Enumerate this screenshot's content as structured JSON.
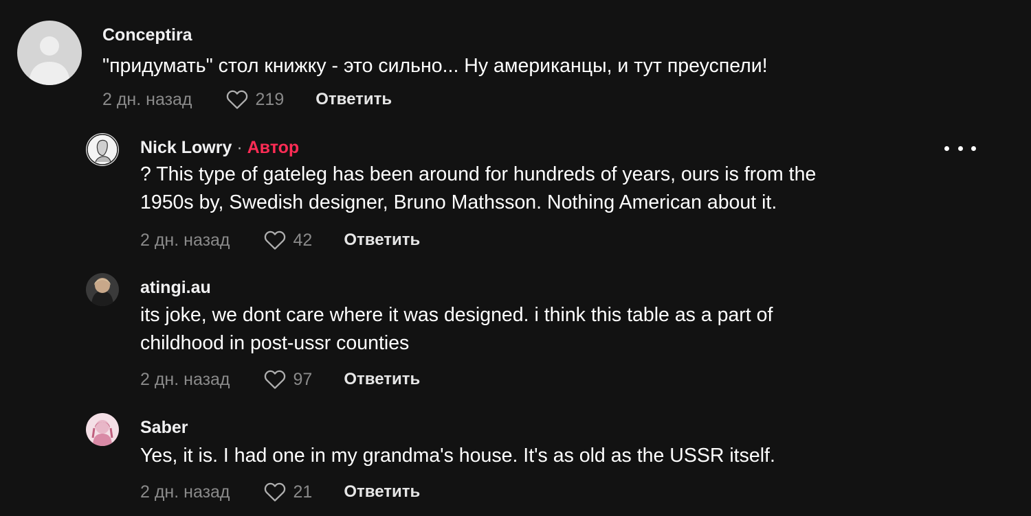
{
  "comments": [
    {
      "username": "Conceptira",
      "text": "\"придумать\" стол книжку - это сильно... Ну американцы, и тут преуспели!",
      "time": "2 дн. назад",
      "likes": "219",
      "reply_label": "Ответить"
    }
  ],
  "replies": [
    {
      "username": "Nick Lowry",
      "separator": "·",
      "author_tag": "Автор",
      "text_lines": [
        "? This type of gateleg has been around for hundreds of years, ours is from the",
        "1950s by, Swedish designer, Bruno Mathsson. Nothing American about it."
      ],
      "time": "2 дн. назад",
      "likes": "42",
      "reply_label": "Ответить"
    },
    {
      "username": "atingi.au",
      "text_lines": [
        "its joke, we dont care where it was designed. i think this table as a part of",
        "childhood in post-ussr counties"
      ],
      "time": "2 дн. назад",
      "likes": "97",
      "reply_label": "Ответить"
    },
    {
      "username": "Saber",
      "text_lines": [
        "Yes, it is. I had one in my grandma's house. It's as old as the USSR itself."
      ],
      "time": "2 дн. назад",
      "likes": "21",
      "reply_label": "Ответить"
    }
  ],
  "icons": {
    "like": "heart-outline-icon",
    "more": "more-horizontal-icon"
  },
  "colors": {
    "background": "#121212",
    "author_tag": "#fe2c55",
    "muted": "#8a8a8a"
  }
}
